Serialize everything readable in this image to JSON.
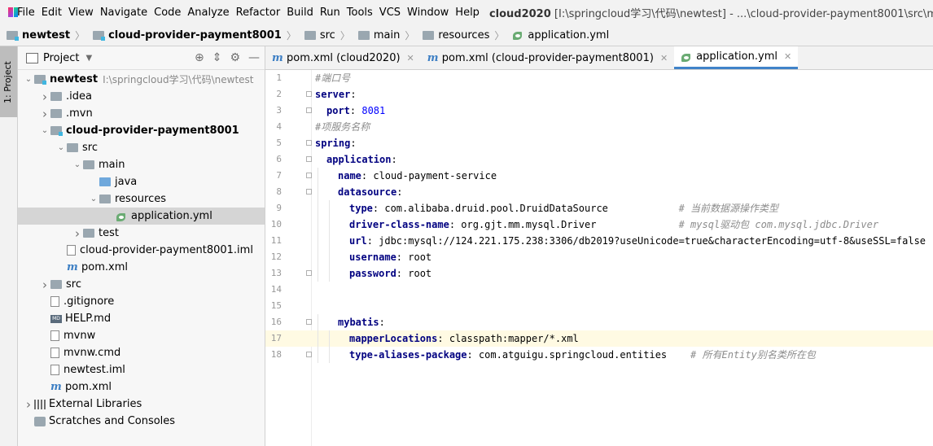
{
  "menu": [
    "File",
    "Edit",
    "View",
    "Navigate",
    "Code",
    "Analyze",
    "Refactor",
    "Build",
    "Run",
    "Tools",
    "VCS",
    "Window",
    "Help"
  ],
  "window_title_project": "cloud2020",
  "window_title_path": "[I:\\springcloud学习\\代码\\newtest] - ...\\cloud-provider-payment8001\\src\\main\\r",
  "breadcrumb": [
    "newtest",
    "cloud-provider-payment8001",
    "src",
    "main",
    "resources",
    "application.yml"
  ],
  "left_strip_tab": "1: Project",
  "project_panel": {
    "title": "Project"
  },
  "tree": [
    {
      "label": "newtest",
      "hint": "I:\\springcloud学习\\代码\\newtest",
      "arrow": "▾",
      "icon": "folder-mod",
      "bold": true,
      "indent": 0
    },
    {
      "label": ".idea",
      "arrow": "›",
      "icon": "folder",
      "indent": 1
    },
    {
      "label": ".mvn",
      "arrow": "›",
      "icon": "folder",
      "indent": 1
    },
    {
      "label": "cloud-provider-payment8001",
      "arrow": "▾",
      "icon": "folder-mod",
      "bold": true,
      "indent": 1
    },
    {
      "label": "src",
      "arrow": "▾",
      "icon": "folder",
      "indent": 2
    },
    {
      "label": "main",
      "arrow": "▾",
      "icon": "folder",
      "indent": 3
    },
    {
      "label": "java",
      "arrow": "",
      "icon": "folder-blue",
      "indent": 4
    },
    {
      "label": "resources",
      "arrow": "▾",
      "icon": "folder",
      "indent": 4
    },
    {
      "label": "application.yml",
      "arrow": "",
      "icon": "yml",
      "indent": 5,
      "selected": true
    },
    {
      "label": "test",
      "arrow": "›",
      "icon": "folder",
      "indent": 3
    },
    {
      "label": "cloud-provider-payment8001.iml",
      "arrow": "",
      "icon": "file",
      "indent": 2
    },
    {
      "label": "pom.xml",
      "arrow": "",
      "icon": "m",
      "indent": 2
    },
    {
      "label": "src",
      "arrow": "›",
      "icon": "folder",
      "indent": 1
    },
    {
      "label": ".gitignore",
      "arrow": "",
      "icon": "file",
      "indent": 1
    },
    {
      "label": "HELP.md",
      "arrow": "",
      "icon": "md",
      "indent": 1
    },
    {
      "label": "mvnw",
      "arrow": "",
      "icon": "file",
      "indent": 1
    },
    {
      "label": "mvnw.cmd",
      "arrow": "",
      "icon": "file",
      "indent": 1
    },
    {
      "label": "newtest.iml",
      "arrow": "",
      "icon": "file",
      "indent": 1
    },
    {
      "label": "pom.xml",
      "arrow": "",
      "icon": "m",
      "indent": 1
    },
    {
      "label": "External Libraries",
      "arrow": "›",
      "icon": "lib",
      "indent": 0
    },
    {
      "label": "Scratches and Consoles",
      "arrow": "",
      "icon": "scratch",
      "indent": 0
    }
  ],
  "tabs": [
    {
      "label": "pom.xml (cloud2020)",
      "icon": "m",
      "active": false
    },
    {
      "label": "pom.xml (cloud-provider-payment8001)",
      "icon": "m",
      "active": false
    },
    {
      "label": "application.yml",
      "icon": "yml",
      "active": true
    }
  ],
  "code_lines": [
    {
      "n": "1",
      "indent": 0,
      "parts": [
        [
          "c",
          "#端口号"
        ]
      ]
    },
    {
      "n": "2",
      "indent": 0,
      "parts": [
        [
          "k",
          "server"
        ],
        [
          "v",
          ":"
        ]
      ],
      "fold": true
    },
    {
      "n": "3",
      "indent": 1,
      "parts": [
        [
          "k",
          "port"
        ],
        [
          "v",
          ": "
        ],
        [
          "n",
          "8081"
        ]
      ],
      "fold": true
    },
    {
      "n": "4",
      "indent": 0,
      "parts": [
        [
          "c",
          "#项服务名称"
        ]
      ]
    },
    {
      "n": "5",
      "indent": 0,
      "parts": [
        [
          "k",
          "spring"
        ],
        [
          "v",
          ":"
        ]
      ],
      "fold": true
    },
    {
      "n": "6",
      "indent": 1,
      "parts": [
        [
          "k",
          "application"
        ],
        [
          "v",
          ":"
        ]
      ],
      "fold": true
    },
    {
      "n": "7",
      "indent": 2,
      "parts": [
        [
          "k",
          "name"
        ],
        [
          "v",
          ": cloud-payment-service"
        ]
      ],
      "fold": true
    },
    {
      "n": "8",
      "indent": 2,
      "parts": [
        [
          "k",
          "datasource"
        ],
        [
          "v",
          ":"
        ]
      ],
      "fold": true
    },
    {
      "n": "9",
      "indent": 3,
      "parts": [
        [
          "k",
          "type"
        ],
        [
          "v",
          ": com.alibaba.druid.pool.DruidDataSource            "
        ],
        [
          "c",
          "# 当前数据源操作类型"
        ]
      ]
    },
    {
      "n": "10",
      "indent": 3,
      "parts": [
        [
          "k",
          "driver-class-name"
        ],
        [
          "v",
          ": org.gjt.mm.mysql.Driver              "
        ],
        [
          "c",
          "# mysql驱动包 com.mysql.jdbc.Driver"
        ]
      ]
    },
    {
      "n": "11",
      "indent": 3,
      "parts": [
        [
          "k",
          "url"
        ],
        [
          "v",
          ": jdbc:mysql://124.221.175.238:3306/db2019?useUnicode=true&characterEncoding=utf-8&useSSL=false"
        ]
      ]
    },
    {
      "n": "12",
      "indent": 3,
      "parts": [
        [
          "k",
          "username"
        ],
        [
          "v",
          ": root"
        ]
      ]
    },
    {
      "n": "13",
      "indent": 3,
      "parts": [
        [
          "k",
          "password"
        ],
        [
          "v",
          ": root"
        ]
      ],
      "fold": true
    },
    {
      "n": "14",
      "indent": 0,
      "parts": []
    },
    {
      "n": "15",
      "indent": 0,
      "parts": []
    },
    {
      "n": "16",
      "indent": 2,
      "parts": [
        [
          "k",
          "mybatis"
        ],
        [
          "v",
          ":"
        ]
      ],
      "fold": true
    },
    {
      "n": "17",
      "indent": 3,
      "parts": [
        [
          "k",
          "mapperLocations"
        ],
        [
          "v",
          ": classpath:mapper/*.xml"
        ]
      ],
      "current": true
    },
    {
      "n": "18",
      "indent": 3,
      "parts": [
        [
          "k",
          "type-aliases-package"
        ],
        [
          "v",
          ": com.atguigu.springcloud.entities    "
        ],
        [
          "c",
          "# 所有Entity别名类所在包"
        ]
      ],
      "fold": true
    }
  ]
}
